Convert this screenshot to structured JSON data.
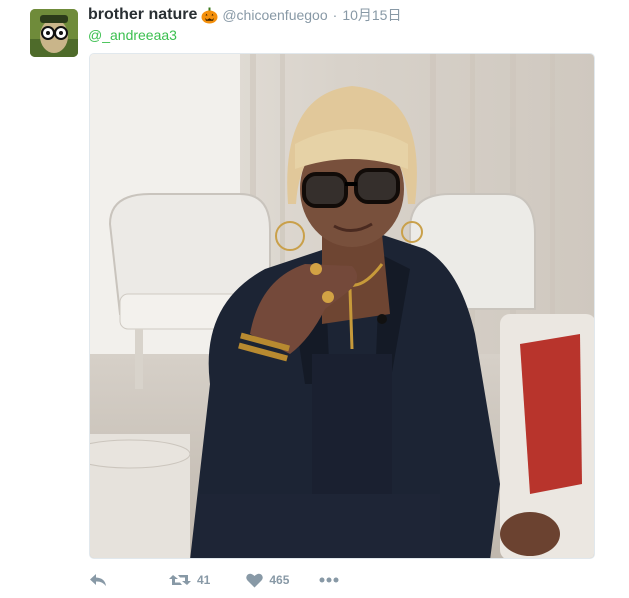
{
  "tweet": {
    "display_name": "brother nature",
    "emoji_icon": "jack-o-lantern-icon",
    "screen_name": "@chicoenfuegoo",
    "separator": "·",
    "timestamp": "10月15日",
    "reply_to": "@_andreeaa3"
  },
  "actions": {
    "reply_icon": "reply-arrow-icon",
    "retweet_icon": "retweet-icon",
    "retweet_count": "41",
    "like_icon": "heart-icon",
    "like_count": "465",
    "more_icon": "more-dots-icon"
  },
  "colors": {
    "link": "#3bbf4f",
    "muted": "#8899a6",
    "text": "#292f33"
  }
}
